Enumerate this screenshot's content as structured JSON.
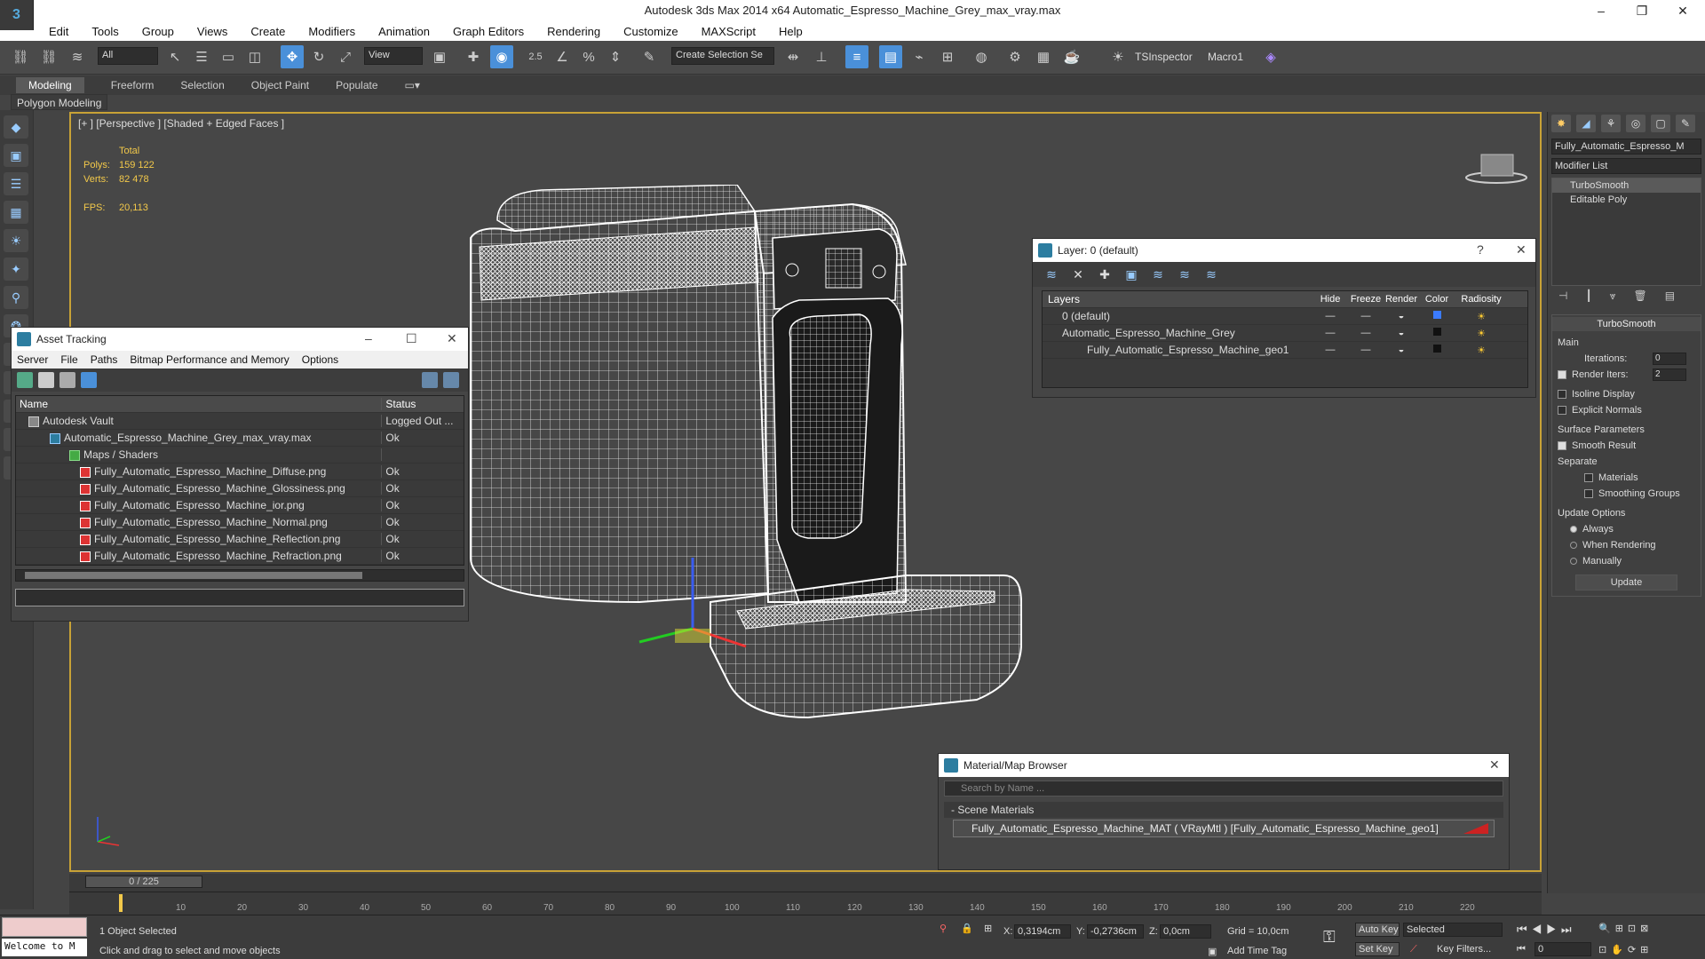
{
  "window": {
    "title": "Autodesk 3ds Max  2014 x64     Automatic_Espresso_Machine_Grey_max_vray.max"
  },
  "menu": [
    "Edit",
    "Tools",
    "Group",
    "Views",
    "Create",
    "Modifiers",
    "Animation",
    "Graph Editors",
    "Rendering",
    "Customize",
    "MAXScript",
    "Help"
  ],
  "toolbar": {
    "selection_filter": "All",
    "ref_coord": "View",
    "named_selection": "Create Selection Se",
    "snap_value": "2.5",
    "tsinspector": "TSInspector",
    "macro": "Macro1"
  },
  "ribbon": {
    "tabs": [
      "Modeling",
      "Freeform",
      "Selection",
      "Object Paint",
      "Populate"
    ],
    "sub": "Polygon Modeling"
  },
  "viewport": {
    "label": "[+ ] [Perspective ] [Shaded + Edged Faces ]",
    "stats": {
      "total": "Total",
      "polys_label": "Polys:",
      "polys": "159 122",
      "verts_label": "Verts:",
      "verts": "82 478",
      "fps_label": "FPS:",
      "fps": "20,113"
    }
  },
  "asset_tracking": {
    "title": "Asset Tracking",
    "menu": [
      "Server",
      "File",
      "Paths",
      "Bitmap Performance and Memory",
      "Options"
    ],
    "columns": [
      "Name",
      "Status"
    ],
    "rows": [
      {
        "name": "Autodesk Vault",
        "status": "Logged Out ..."
      },
      {
        "name": "Automatic_Espresso_Machine_Grey_max_vray.max",
        "status": "Ok"
      },
      {
        "name": "Maps / Shaders",
        "status": ""
      },
      {
        "name": "Fully_Automatic_Espresso_Machine_Diffuse.png",
        "status": "Ok"
      },
      {
        "name": "Fully_Automatic_Espresso_Machine_Glossiness.png",
        "status": "Ok"
      },
      {
        "name": "Fully_Automatic_Espresso_Machine_ior.png",
        "status": "Ok"
      },
      {
        "name": "Fully_Automatic_Espresso_Machine_Normal.png",
        "status": "Ok"
      },
      {
        "name": "Fully_Automatic_Espresso_Machine_Reflection.png",
        "status": "Ok"
      },
      {
        "name": "Fully_Automatic_Espresso_Machine_Refraction.png",
        "status": "Ok"
      }
    ]
  },
  "layers": {
    "title": "Layer: 0 (default)",
    "columns": [
      "Layers",
      "Hide",
      "Freeze",
      "Render",
      "Color",
      "Radiosity"
    ],
    "rows": [
      {
        "name": "0 (default)"
      },
      {
        "name": "Automatic_Espresso_Machine_Grey"
      },
      {
        "name": "Fully_Automatic_Espresso_Machine_geo1"
      }
    ]
  },
  "material_browser": {
    "title": "Material/Map Browser",
    "search_placeholder": "Search by Name ...",
    "section": "- Scene Materials",
    "item": "Fully_Automatic_Espresso_Machine_MAT ( VRayMtl ) [Fully_Automatic_Espresso_Machine_geo1]"
  },
  "command_panel": {
    "object_name": "Fully_Automatic_Espresso_M",
    "modifier_list": "Modifier List",
    "stack": [
      "TurboSmooth",
      "Editable Poly"
    ],
    "turbosmooth": {
      "title": "TurboSmooth",
      "main": "Main",
      "iterations_label": "Iterations:",
      "iterations": "0",
      "render_iters_label": "Render Iters:",
      "render_iters": "2",
      "isoline": "Isoline Display",
      "explicit": "Explicit Normals",
      "surface": "Surface Parameters",
      "smooth_result": "Smooth Result",
      "separate": "Separate",
      "materials": "Materials",
      "smoothing": "Smoothing Groups",
      "update_options": "Update Options",
      "always": "Always",
      "when_rendering": "When Rendering",
      "manually": "Manually",
      "update": "Update"
    }
  },
  "timeline": {
    "slider": "0 / 225",
    "ticks": [
      "10",
      "20",
      "30",
      "40",
      "50",
      "60",
      "70",
      "80",
      "90",
      "100",
      "110",
      "120",
      "130",
      "140",
      "150",
      "160",
      "170",
      "180",
      "190",
      "200",
      "210",
      "220"
    ]
  },
  "status": {
    "maxscript": "Welcome to M",
    "selected": "1 Object Selected",
    "prompt": "Click and drag to select and move objects",
    "x_label": "X:",
    "x": "0,3194cm",
    "y_label": "Y:",
    "y": "-0,2736cm",
    "z_label": "Z:",
    "z": "0,0cm",
    "grid": "Grid = 10,0cm",
    "add_time_tag": "Add Time Tag",
    "auto_key": "Auto Key",
    "set_key": "Set Key",
    "key_mode": "Selected",
    "key_filters": "Key Filters...",
    "frame": "0"
  }
}
